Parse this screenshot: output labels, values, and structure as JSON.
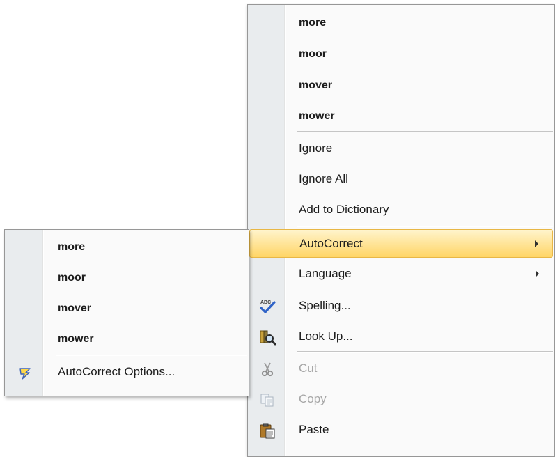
{
  "context_menu": {
    "suggestions": [
      "more",
      "moor",
      "mover",
      "mower"
    ],
    "ignore_label": "Ignore",
    "ignore_all_label": "Ignore All",
    "add_to_dictionary_label": "Add to Dictionary",
    "autocorrect_label": "AutoCorrect",
    "language_label": "Language",
    "spelling_label": "Spelling...",
    "look_up_label": "Look Up...",
    "cut_label": "Cut",
    "copy_label": "Copy",
    "paste_label": "Paste"
  },
  "autocorrect_submenu": {
    "suggestions": [
      "more",
      "moor",
      "mover",
      "mower"
    ],
    "options_label": "AutoCorrect Options..."
  },
  "icons": {
    "spelling": "spelling-check-icon",
    "look_up": "research-book-icon",
    "cut": "scissors-icon",
    "copy": "copy-icon",
    "paste": "paste-clipboard-icon",
    "autocorrect_options": "lightning-bolt-icon"
  },
  "colors": {
    "highlight_top": "#fff4cc",
    "highlight_bottom": "#ffd566",
    "gutter": "#e9ecee",
    "disabled_text": "#a6a6a6"
  }
}
